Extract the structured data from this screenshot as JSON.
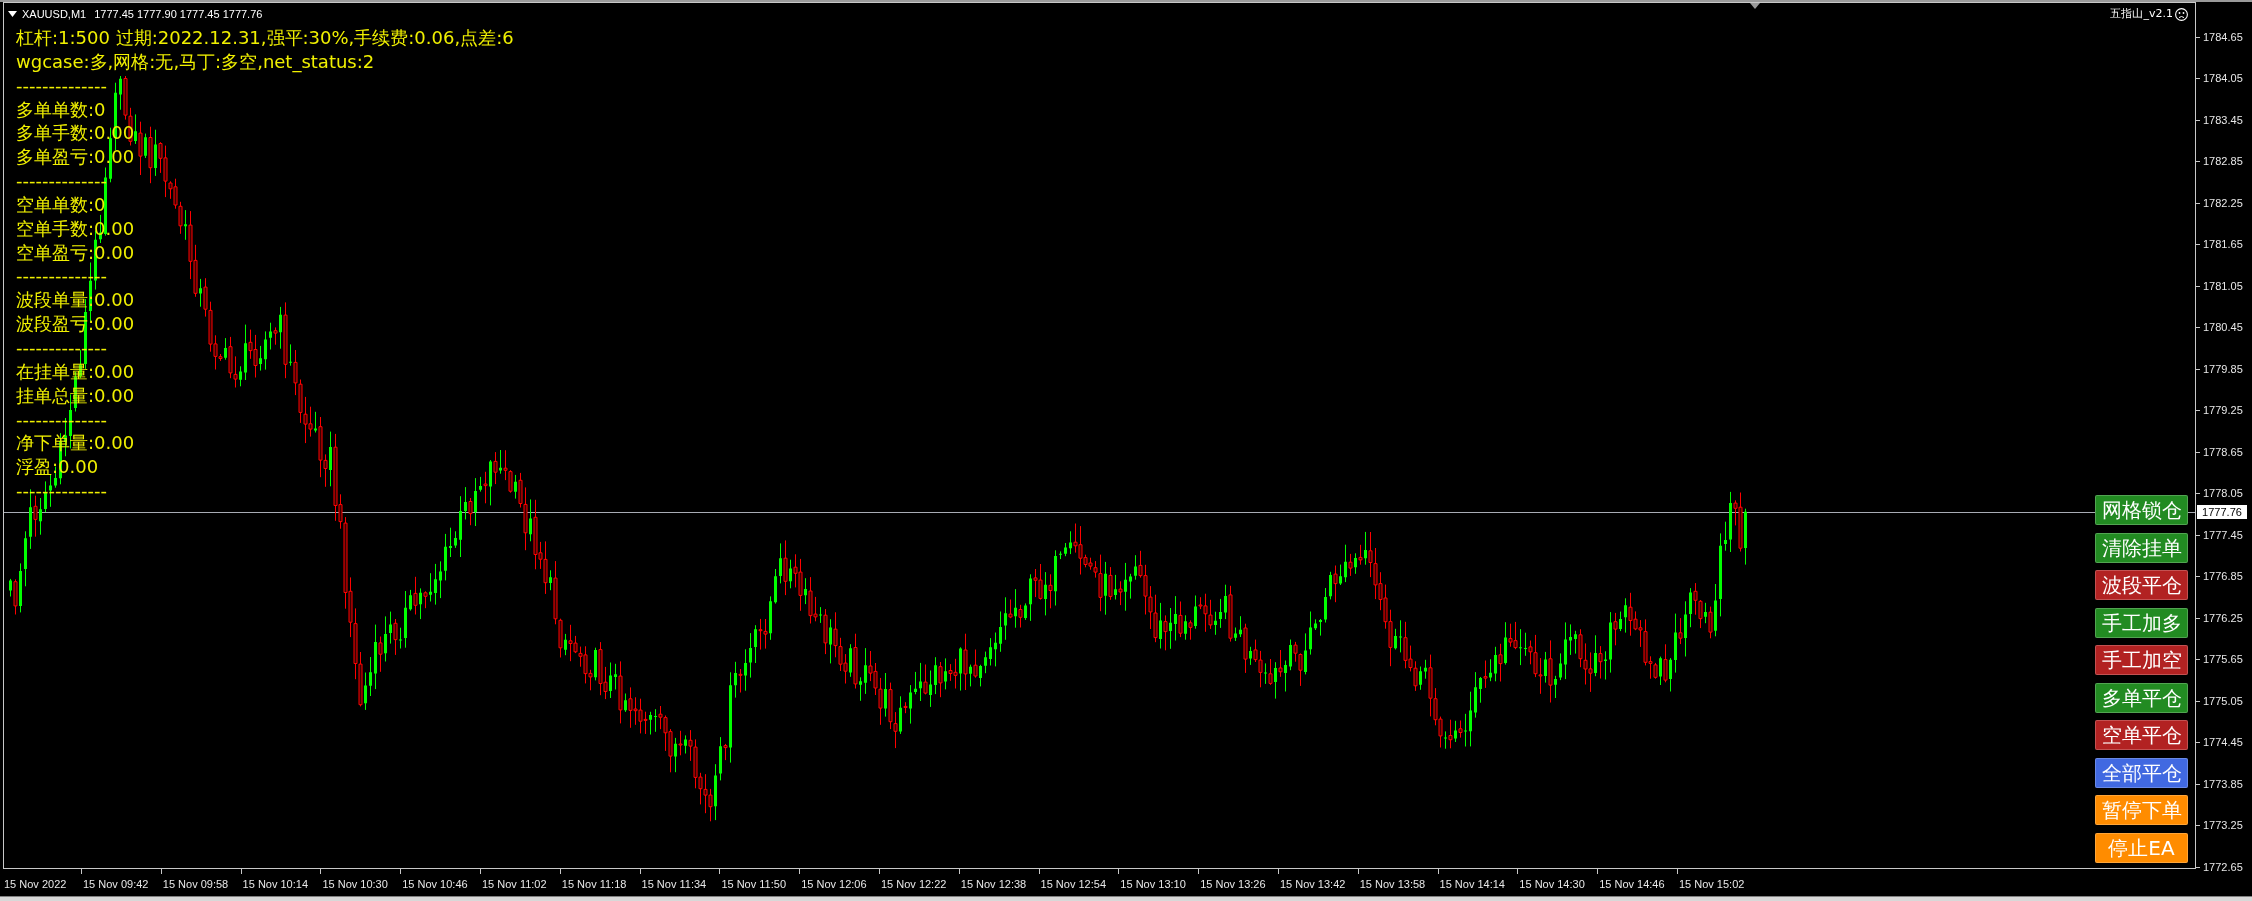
{
  "chart": {
    "symbol": "XAUUSD,M1",
    "ohlc": "1777.45 1777.90 1777.45 1777.76",
    "expert_name": "五指山_v2.1"
  },
  "info_panel": {
    "lines": [
      "杠杆:1:500 过期:2022.12.31,强平:30%,手续费:0.06,点差:6",
      "wgcase:多,网格:无,马丁:多空,net_status:2",
      "--------------",
      "多单单数:0",
      "多单手数:0.00",
      "多单盈亏:0.00",
      "--------------",
      "空单单数:0",
      "空单手数:0.00",
      "空单盈亏:0.00",
      "--------------",
      "波段单量:0.00",
      "波段盈亏:0.00",
      "--------------",
      "在挂单量:0.00",
      "挂单总量:0.00",
      "--------------",
      "净下单量:0.00",
      "浮盈:0.00",
      "--------------"
    ]
  },
  "buttons": [
    {
      "label": "网格锁仓",
      "color": "#228b22"
    },
    {
      "label": "清除挂单",
      "color": "#228b22"
    },
    {
      "label": "波段平仓",
      "color": "#b22222"
    },
    {
      "label": "手工加多",
      "color": "#228b22"
    },
    {
      "label": "手工加空",
      "color": "#b22222"
    },
    {
      "label": "多单平仓",
      "color": "#228b22"
    },
    {
      "label": "空单平仓",
      "color": "#b22222"
    },
    {
      "label": "全部平仓",
      "color": "#4169e1"
    },
    {
      "label": "暂停下单",
      "color": "#ff8c00"
    },
    {
      "label": "停止EA",
      "color": "#ff8c00"
    }
  ],
  "price_axis": {
    "labels": [
      "1784.65",
      "1784.05",
      "1783.45",
      "1782.85",
      "1782.25",
      "1781.65",
      "1781.05",
      "1780.45",
      "1779.85",
      "1779.25",
      "1778.65",
      "1778.05",
      "1777.45",
      "1776.85",
      "1776.25",
      "1775.65",
      "1775.05",
      "1774.45",
      "1773.85",
      "1773.25",
      "1772.65"
    ],
    "current_price": "1777.76"
  },
  "time_axis": {
    "labels": [
      "15 Nov 2022",
      "15 Nov 09:42",
      "15 Nov 09:58",
      "15 Nov 10:14",
      "15 Nov 10:30",
      "15 Nov 10:46",
      "15 Nov 11:02",
      "15 Nov 11:18",
      "15 Nov 11:34",
      "15 Nov 11:50",
      "15 Nov 12:06",
      "15 Nov 12:22",
      "15 Nov 12:38",
      "15 Nov 12:54",
      "15 Nov 13:10",
      "15 Nov 13:26",
      "15 Nov 13:42",
      "15 Nov 13:58",
      "15 Nov 14:14",
      "15 Nov 14:30",
      "15 Nov 14:46",
      "15 Nov 15:02"
    ]
  }
}
